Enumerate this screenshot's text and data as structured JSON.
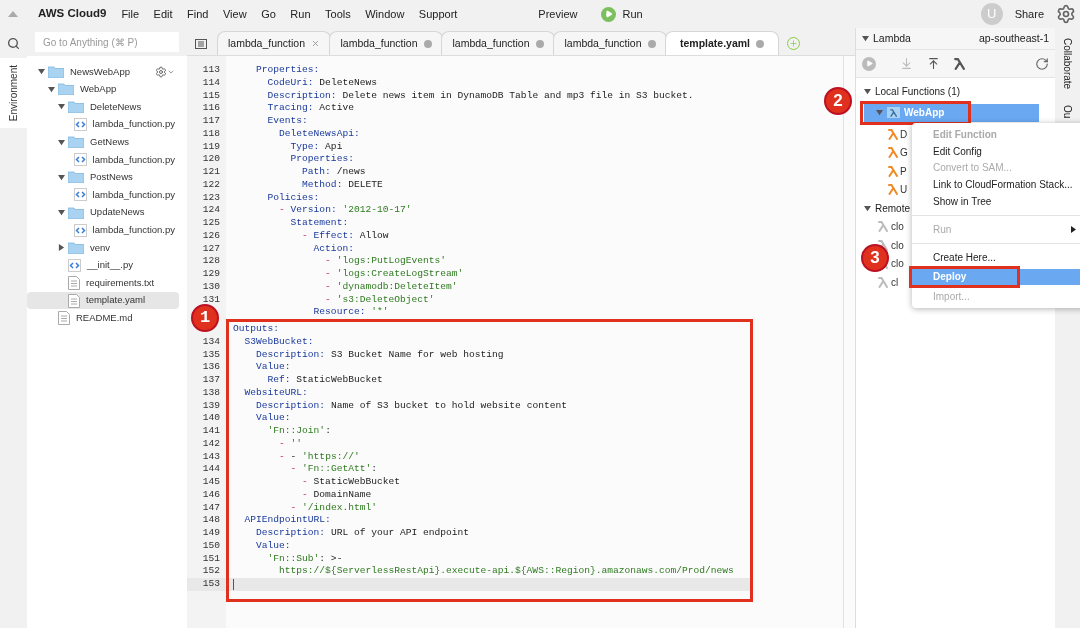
{
  "menu_bar": {
    "brand": "AWS Cloud9",
    "items": [
      "File",
      "Edit",
      "Find",
      "View",
      "Go",
      "Run",
      "Tools",
      "Window",
      "Support"
    ],
    "preview": "Preview",
    "run": "Run",
    "avatar": "U",
    "share": "Share"
  },
  "side_tabs": {
    "left": "Environment",
    "right": [
      "Collaborate",
      "Ou"
    ]
  },
  "search": {
    "placeholder": "Go to Anything (⌘ P)"
  },
  "file_tree": [
    {
      "name": "NewsWebApp",
      "kind": "folder",
      "expanded": true,
      "selected": false,
      "children": [
        {
          "name": "WebApp",
          "kind": "folder",
          "expanded": true,
          "selected": false,
          "children": [
            {
              "name": "DeleteNews",
              "kind": "folder",
              "expanded": true,
              "selected": false,
              "children": [
                {
                  "name": "lambda_function.py",
                  "kind": "code",
                  "selected": false
                }
              ]
            },
            {
              "name": "GetNews",
              "kind": "folder",
              "expanded": true,
              "selected": false,
              "children": [
                {
                  "name": "lambda_function.py",
                  "kind": "code",
                  "selected": false
                }
              ]
            },
            {
              "name": "PostNews",
              "kind": "folder",
              "expanded": true,
              "selected": false,
              "children": [
                {
                  "name": "lambda_function.py",
                  "kind": "code",
                  "selected": false
                }
              ]
            },
            {
              "name": "UpdateNews",
              "kind": "folder",
              "expanded": true,
              "selected": false,
              "children": [
                {
                  "name": "lambda_function.py",
                  "kind": "code",
                  "selected": false
                }
              ]
            },
            {
              "name": "venv",
              "kind": "folder",
              "expanded": false,
              "selected": false
            },
            {
              "name": "__init__.py",
              "kind": "code",
              "selected": false
            },
            {
              "name": "requirements.txt",
              "kind": "text",
              "selected": false
            },
            {
              "name": "template.yaml",
              "kind": "text",
              "selected": true
            }
          ]
        },
        {
          "name": "README.md",
          "kind": "text",
          "selected": false
        }
      ]
    }
  ],
  "tabs": [
    {
      "label": "lambda_function",
      "selected": false,
      "modified": false
    },
    {
      "label": "lambda_function",
      "selected": false,
      "modified": true
    },
    {
      "label": "lambda_function",
      "selected": false,
      "modified": true
    },
    {
      "label": "lambda_function",
      "selected": false,
      "modified": true
    },
    {
      "label": "template.yaml",
      "selected": true,
      "modified": true
    }
  ],
  "code_lines": [
    {
      "number": "113",
      "active": false,
      "tokens": [
        {
          "kind": "key",
          "text": "    Properties:"
        }
      ]
    },
    {
      "number": "114",
      "active": false,
      "tokens": [
        {
          "kind": "key",
          "text": "      CodeUri:"
        },
        {
          "kind": "plain",
          "text": " DeleteNews"
        }
      ]
    },
    {
      "number": "115",
      "active": false,
      "tokens": [
        {
          "kind": "key",
          "text": "      Description:"
        },
        {
          "kind": "plain",
          "text": " Delete news item in DynamoDB Table and mp3 file in S3 bucket."
        }
      ]
    },
    {
      "number": "116",
      "active": false,
      "tokens": [
        {
          "kind": "key",
          "text": "      Tracing:"
        },
        {
          "kind": "plain",
          "text": " Active"
        }
      ]
    },
    {
      "number": "117",
      "active": false,
      "tokens": [
        {
          "kind": "key",
          "text": "      Events:"
        }
      ]
    },
    {
      "number": "118",
      "active": false,
      "tokens": [
        {
          "kind": "key",
          "text": "        DeleteNewsApi:"
        }
      ]
    },
    {
      "number": "119",
      "active": false,
      "tokens": [
        {
          "kind": "key",
          "text": "          Type:"
        },
        {
          "kind": "plain",
          "text": " Api"
        }
      ]
    },
    {
      "number": "120",
      "active": false,
      "tokens": [
        {
          "kind": "key",
          "text": "          Properties:"
        }
      ]
    },
    {
      "number": "121",
      "active": false,
      "tokens": [
        {
          "kind": "key",
          "text": "            Path:"
        },
        {
          "kind": "plain",
          "text": " /news"
        }
      ]
    },
    {
      "number": "122",
      "active": false,
      "tokens": [
        {
          "kind": "key",
          "text": "            Method:"
        },
        {
          "kind": "plain",
          "text": " DELETE"
        }
      ]
    },
    {
      "number": "123",
      "active": false,
      "tokens": [
        {
          "kind": "key",
          "text": "      Policies:"
        }
      ]
    },
    {
      "number": "124",
      "active": false,
      "tokens": [
        {
          "kind": "dash",
          "text": "        -"
        },
        {
          "kind": "key",
          "text": " Version:"
        },
        {
          "kind": "string",
          "text": " '2012-10-17'"
        }
      ]
    },
    {
      "number": "125",
      "active": false,
      "tokens": [
        {
          "kind": "key",
          "text": "          Statement:"
        }
      ]
    },
    {
      "number": "126",
      "active": false,
      "tokens": [
        {
          "kind": "dash",
          "text": "            -"
        },
        {
          "kind": "key",
          "text": " Effect:"
        },
        {
          "kind": "plain",
          "text": " Allow"
        }
      ]
    },
    {
      "number": "127",
      "active": false,
      "tokens": [
        {
          "kind": "key",
          "text": "              Action:"
        }
      ]
    },
    {
      "number": "128",
      "active": false,
      "tokens": [
        {
          "kind": "dash",
          "text": "                -"
        },
        {
          "kind": "string",
          "text": " 'logs:PutLogEvents'"
        }
      ]
    },
    {
      "number": "129",
      "active": false,
      "tokens": [
        {
          "kind": "dash",
          "text": "                -"
        },
        {
          "kind": "string",
          "text": " 'logs:CreateLogStream'"
        }
      ]
    },
    {
      "number": "130",
      "active": false,
      "tokens": [
        {
          "kind": "dash",
          "text": "                -"
        },
        {
          "kind": "string",
          "text": " 'dynamodb:DeleteItem'"
        }
      ]
    },
    {
      "number": "131",
      "active": false,
      "tokens": [
        {
          "kind": "dash",
          "text": "                -"
        },
        {
          "kind": "string",
          "text": " 's3:DeleteObject'"
        }
      ]
    },
    {
      "active": false,
      "tokens": [
        {
          "kind": "key",
          "text": "              Resource:"
        },
        {
          "kind": "string",
          "text": " '*'"
        }
      ]
    }
  ],
  "highlighted_code_lines": [
    {
      "active": false,
      "tokens": [
        {
          "kind": "key",
          "text": "Outputs:"
        }
      ]
    },
    {
      "number": "134",
      "active": false,
      "tokens": [
        {
          "kind": "key",
          "text": "  S3WebBucket:"
        }
      ]
    },
    {
      "number": "135",
      "active": false,
      "tokens": [
        {
          "kind": "key",
          "text": "    Description:"
        },
        {
          "kind": "plain",
          "text": " S3 Bucket Name for web hosting"
        }
      ]
    },
    {
      "number": "136",
      "active": false,
      "tokens": [
        {
          "kind": "key",
          "text": "    Value:"
        }
      ]
    },
    {
      "number": "137",
      "active": false,
      "tokens": [
        {
          "kind": "key",
          "text": "      Ref:"
        },
        {
          "kind": "plain",
          "text": " StaticWebBucket"
        }
      ]
    },
    {
      "number": "138",
      "active": false,
      "tokens": [
        {
          "kind": "key",
          "text": "  WebsiteURL:"
        }
      ]
    },
    {
      "number": "139",
      "active": false,
      "tokens": [
        {
          "kind": "key",
          "text": "    Description:"
        },
        {
          "kind": "plain",
          "text": " Name of S3 bucket to hold website content"
        }
      ]
    },
    {
      "number": "140",
      "active": false,
      "tokens": [
        {
          "kind": "key",
          "text": "    Value:"
        }
      ]
    },
    {
      "number": "141",
      "active": false,
      "tokens": [
        {
          "kind": "string",
          "text": "      'Fn::Join'"
        },
        {
          "kind": "plain",
          "text": ":"
        }
      ]
    },
    {
      "number": "142",
      "active": false,
      "tokens": [
        {
          "kind": "dash",
          "text": "        -"
        },
        {
          "kind": "string",
          "text": " ''"
        }
      ]
    },
    {
      "number": "143",
      "active": false,
      "tokens": [
        {
          "kind": "dash",
          "text": "        -"
        },
        {
          "kind": "plain",
          "text": " -"
        },
        {
          "kind": "string",
          "text": " 'https://'"
        }
      ]
    },
    {
      "number": "144",
      "active": false,
      "tokens": [
        {
          "kind": "dash",
          "text": "          -"
        },
        {
          "kind": "string",
          "text": " 'Fn::GetAtt'"
        },
        {
          "kind": "plain",
          "text": ":"
        }
      ]
    },
    {
      "number": "145",
      "active": false,
      "tokens": [
        {
          "kind": "dash",
          "text": "            -"
        },
        {
          "kind": "plain",
          "text": " StaticWebBucket"
        }
      ]
    },
    {
      "number": "146",
      "active": false,
      "tokens": [
        {
          "kind": "dash",
          "text": "            -"
        },
        {
          "kind": "plain",
          "text": " DomainName"
        }
      ]
    },
    {
      "number": "147",
      "active": false,
      "tokens": [
        {
          "kind": "dash",
          "text": "          -"
        },
        {
          "kind": "string",
          "text": " '/index.html'"
        }
      ]
    },
    {
      "number": "148",
      "active": false,
      "tokens": [
        {
          "kind": "key",
          "text": "  APIEndpointURL:"
        }
      ]
    },
    {
      "number": "149",
      "active": false,
      "tokens": [
        {
          "kind": "key",
          "text": "    Description:"
        },
        {
          "kind": "plain",
          "text": " URL of your API endpoint"
        }
      ]
    },
    {
      "number": "150",
      "active": false,
      "tokens": [
        {
          "kind": "key",
          "text": "    Value:"
        }
      ]
    },
    {
      "number": "151",
      "active": false,
      "tokens": [
        {
          "kind": "string",
          "text": "      'Fn::Sub'"
        },
        {
          "kind": "plain",
          "text": ": >-"
        }
      ]
    },
    {
      "number": "152",
      "active": false,
      "tokens": [
        {
          "kind": "string",
          "text": "        https://${ServerlessRestApi}.execute-api.${AWS::Region}.amazonaws.com/Prod/news"
        }
      ]
    },
    {
      "number": "153",
      "active": true
    }
  ],
  "lambda_panel": {
    "title": "Lambda",
    "region": "ap-southeast-1",
    "groups": [
      {
        "label": "Local Functions (1)",
        "expanded": true,
        "items": [
          {
            "label": "WebApp",
            "kind": "app",
            "selected": true
          },
          {
            "label": "D",
            "kind": "function",
            "selected": false
          },
          {
            "label": "G",
            "kind": "function",
            "selected": false
          },
          {
            "label": "P",
            "kind": "function",
            "selected": false
          },
          {
            "label": "U",
            "kind": "function",
            "selected": false
          }
        ]
      },
      {
        "label": "Remote",
        "expanded": true,
        "items": [
          {
            "label": "clo",
            "kind": "remote",
            "selected": false
          },
          {
            "label": "clo",
            "kind": "remote",
            "selected": false
          },
          {
            "label": "clo",
            "kind": "remote",
            "selected": false
          },
          {
            "label": "cl",
            "kind": "remote",
            "selected": false
          }
        ]
      }
    ]
  },
  "context_menu": [
    {
      "kind": "item",
      "label": "Edit Function",
      "disabled": true,
      "selected": false,
      "submenu": false
    },
    {
      "kind": "item",
      "label": "Edit Config",
      "disabled": false,
      "selected": false,
      "submenu": false
    },
    {
      "kind": "item",
      "label": "Convert to SAM...",
      "disabled": true,
      "selected": false,
      "submenu": false
    },
    {
      "kind": "item",
      "label": "Link to CloudFormation Stack...",
      "disabled": false,
      "selected": false,
      "submenu": false
    },
    {
      "kind": "item",
      "label": "Show in Tree",
      "disabled": false,
      "selected": false,
      "submenu": false
    },
    {
      "kind": "separator"
    },
    {
      "kind": "item",
      "label": "Run",
      "disabled": true,
      "selected": false,
      "submenu": true
    },
    {
      "kind": "separator"
    },
    {
      "kind": "item",
      "label": "Create Here...",
      "disabled": false,
      "selected": false,
      "submenu": false
    },
    {
      "kind": "item",
      "label": "Deploy",
      "disabled": false,
      "selected": true,
      "submenu": false
    },
    {
      "kind": "item",
      "label": "Import...",
      "disabled": true,
      "selected": false,
      "submenu": false
    }
  ],
  "callouts": [
    {
      "label": "1"
    },
    {
      "label": "2"
    },
    {
      "label": "3"
    }
  ]
}
